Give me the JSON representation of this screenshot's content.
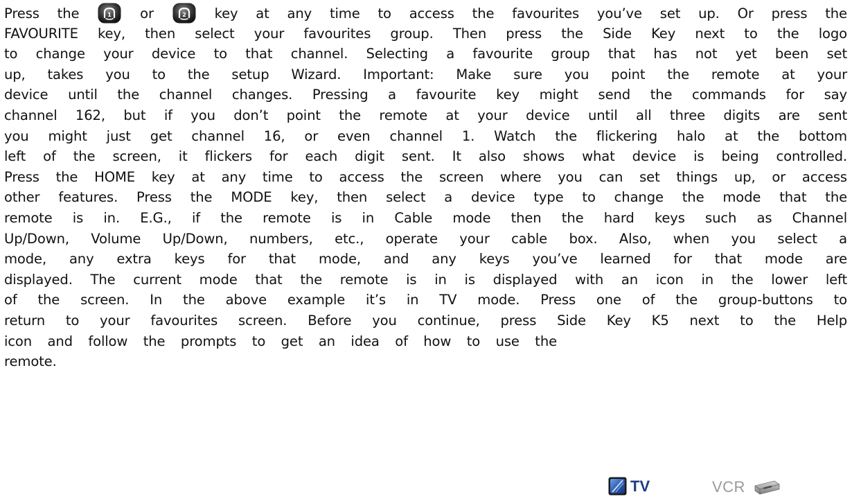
{
  "document": {
    "line1_a": "Press the",
    "line1_b": "or",
    "line1_c": "key at any time to access the favourites you’ve set up. Or press the",
    "lines": [
      "FAVOURITE key, then select your favourites group. Then press the Side Key next to the logo",
      "to change your device to that channel. Selecting a favourite group that has not yet been set",
      "up, takes you to the setup Wizard. Important: Make sure you point the remote at your",
      "device until the channel changes. Pressing a favourite key might send the commands for say",
      "channel 162, but if you don’t point the remote at your device until all three digits are sent",
      "you might just get channel 16, or even channel 1. Watch the flickering halo at the bottom",
      "left of the screen, it flickers for each digit sent. It also shows what device is being controlled.",
      "Press the HOME key at any time to access the screen where you can set things up, or access",
      "other features. Press the MODE key, then select a device type to change the mode that the",
      "remote is in. E.G., if the remote is in Cable mode then the hard keys such as Channel",
      "Up/Down, Volume Up/Down, numbers, etc., operate your cable box. Also, when you select a",
      "mode, any extra keys for that mode, and any keys you’ve learned for that mode are",
      "displayed. The current mode that the remote is in is displayed with an icon in the lower left",
      "of the screen. In the above example it’s in TV mode. Press one of the group-buttons to",
      "return to your favourites screen. Before you continue, press Side Key K5 next to the Help",
      "icon and follow the prompts to get an idea of how to use the"
    ],
    "last_line": "remote."
  },
  "key_icons": [
    {
      "name": "favourite-key-1-icon",
      "digit": "1"
    },
    {
      "name": "favourite-key-2-icon",
      "digit": "2"
    }
  ],
  "mode_strip": {
    "tv_label": "TV",
    "vcr_label": "VCR",
    "tv_color": "#1f3d80",
    "vcr_color": "#9a9a9a"
  }
}
